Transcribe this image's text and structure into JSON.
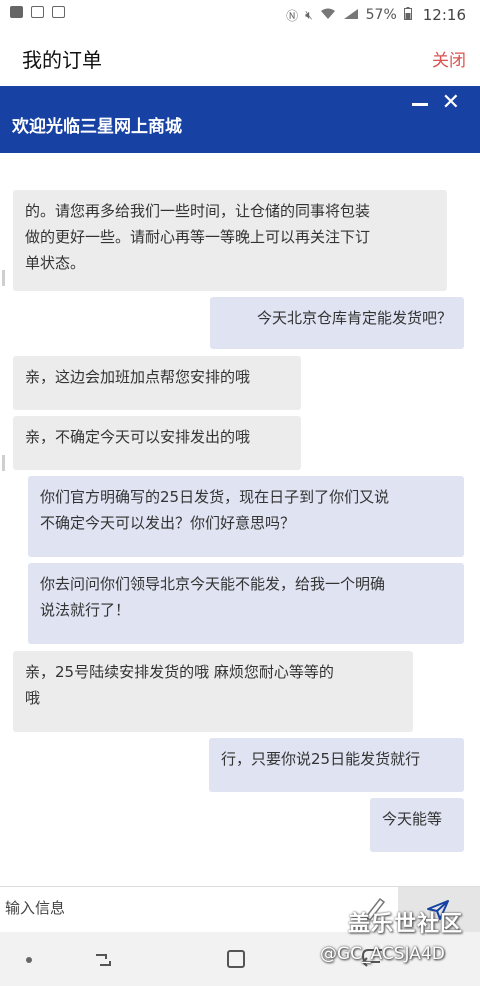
{
  "status_bar": {
    "battery": "57%",
    "time": "12:16"
  },
  "header": {
    "title": "我的订单",
    "close_label": "关闭"
  },
  "banner": {
    "title": "欢迎光临三星网上商城"
  },
  "messages": [
    {
      "side": "left",
      "text": "的。请您再多给我们一些时间，让仓储的同事将包装\n做的更好一些。请耐心再等一等晚上可以再关注下订\n单状态。"
    },
    {
      "side": "right",
      "text": "今天北京仓库肯定能发货吧？"
    },
    {
      "side": "left",
      "text": "亲，这边会加班加点帮您安排的哦"
    },
    {
      "side": "left",
      "text": "亲，不确定今天可以安排发出的哦"
    },
    {
      "side": "right",
      "text": "你们官方明确写的25日发货，现在日子到了你们又说\n不确定今天可以发出？你们好意思吗？"
    },
    {
      "side": "right",
      "text": "你去问问你们领导北京今天能不能发，给我一个明确\n说法就行了！"
    },
    {
      "side": "left",
      "text": "亲，25号陆续安排发货的哦 麻烦您耐心等等的\n哦"
    },
    {
      "side": "right",
      "text": "行，只要你说25日能发货就行"
    },
    {
      "side": "right",
      "text": "今天能等"
    }
  ],
  "input": {
    "placeholder": "输入信息"
  },
  "watermark": {
    "brand": "盖乐世社区",
    "user": "@GC_ACSJA4D"
  },
  "icons": [
    "camera-icon",
    "gallery-icon",
    "check-icon",
    "nfc-icon",
    "mute-icon",
    "wifi-icon",
    "signal-icon",
    "minimize-icon",
    "close-icon",
    "pen-icon",
    "send-icon",
    "nav-recent-icon",
    "nav-home-icon",
    "nav-back-icon"
  ]
}
